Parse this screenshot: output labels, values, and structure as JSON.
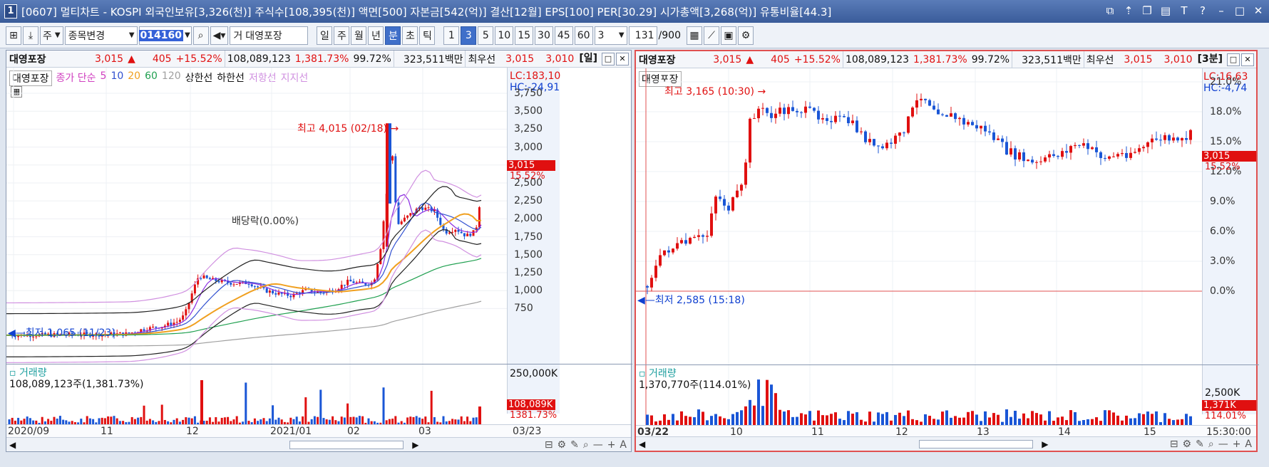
{
  "window": {
    "num": "1",
    "title": "[0607] 멀티차트 - KOSPI 외국인보유[3,326(천)] 주식수[108,395(천)] 액면[500] 자본금[542(억)] 결산[12월] EPS[100] PER[30.29] 시가총액[3,268(억)] 유통비율[44.3]"
  },
  "toolbar": {
    "mode": "주",
    "change": "종목변경",
    "code": "014160",
    "name": "대영포장",
    "periods": [
      "일",
      "주",
      "월",
      "년",
      "분",
      "초",
      "틱"
    ],
    "active_period": "분",
    "intervals": [
      "1",
      "3",
      "5",
      "10",
      "15",
      "30",
      "45",
      "60"
    ],
    "active_interval": "3",
    "interval_value": "3",
    "count": "131",
    "count_max": "/900",
    "name_prefix": "거"
  },
  "left": {
    "name": "대영포장",
    "price": "3,015",
    "arrow": "▲",
    "change": "405",
    "rate": "+15.52%",
    "volume": "108,089,123",
    "vol_rate": "1,381.73%",
    "ratio": "99.72%",
    "amount": "323,511백만",
    "best": "최우선",
    "bid": "3,015",
    "ask": "3,010",
    "period": "[일]",
    "legend": {
      "name": "대영포장",
      "close": "종가 단순",
      "ma5": "5",
      "ma10": "10",
      "ma20": "20",
      "ma60": "60",
      "ma120": "120",
      "upper": "상한선",
      "lower": "하한선",
      "resist": "저항선",
      "support": "지지선"
    },
    "lc": "LC:183,10",
    "hc": "HC:-24,91",
    "high_label": "최고 4,015 (02/18)",
    "low_label": "최저 1,065 (11/23)",
    "ex_label": "배당락(0.00%)",
    "yticks": [
      "3,750",
      "3,500",
      "3,250",
      "3,000",
      "2,750",
      "2,500",
      "2,250",
      "2,000",
      "1,750",
      "1,500",
      "1,250",
      "1,000",
      "750"
    ],
    "tag_price": "3,015",
    "tag_rate": "15.52%",
    "vol_title": "거래량",
    "vol_value": "108,089,123주(1,381.73%)",
    "vol_tick": "250,000K",
    "vol_tag": "108,089K",
    "vol_tag_rate": "1381.73%",
    "xlabels": [
      "2020/09",
      "11",
      "12",
      "2021/01",
      "02",
      "03"
    ],
    "xend": "03/23"
  },
  "right": {
    "name": "대영포장",
    "price": "3,015",
    "arrow": "▲",
    "change": "405",
    "rate": "+15.52%",
    "volume": "108,089,123",
    "vol_rate": "1,381.73%",
    "ratio": "99.72%",
    "amount": "323,511백만",
    "best": "최우선",
    "bid": "3,015",
    "ask": "3,010",
    "period": "[3분]",
    "legend": {
      "name": "대영포장"
    },
    "lc": "LC:16,63",
    "hc": "HC:-4,74",
    "high_label": "최고 3,165 (10:30)",
    "low_label": "최저 2,585 (15:18)",
    "yticks": [
      "21.0%",
      "18.0%",
      "15.0%",
      "12.0%",
      "9.0%",
      "6.0%",
      "3.0%",
      "0.0%"
    ],
    "tag_price": "3,015",
    "tag_rate": "15.52%",
    "vol_title": "거래량",
    "vol_value": "1,370,770주(114.01%)",
    "vol_tick": "2,500K",
    "vol_tag": "1,371K",
    "vol_tag_rate": "114.01%",
    "xlabels": [
      "03/22",
      "10",
      "11",
      "12",
      "13",
      "14",
      "15"
    ],
    "xend": "15:30:00"
  },
  "colors": {
    "up": "#e01010",
    "down": "#1a56d6",
    "ma5": "#8a2be2",
    "ma10": "#3050d0",
    "ma20": "#f0a020",
    "ma60": "#20a050",
    "ma120": "#a0a0a0"
  }
}
